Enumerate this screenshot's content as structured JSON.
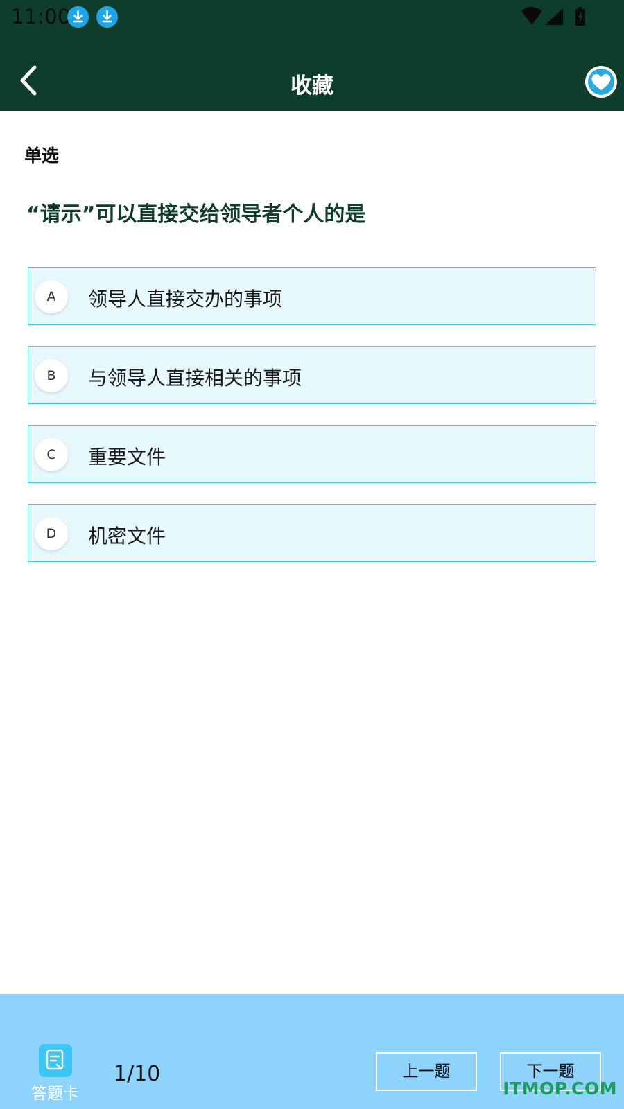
{
  "status_bar": {
    "time": "11:00"
  },
  "header": {
    "title": "收藏"
  },
  "question": {
    "type": "单选",
    "text": "“请示”可以直接交给领导者个人的是",
    "options": [
      {
        "letter": "A",
        "text": "领导人直接交办的事项"
      },
      {
        "letter": "B",
        "text": "与领导人直接相关的事项"
      },
      {
        "letter": "C",
        "text": "重要文件"
      },
      {
        "letter": "D",
        "text": "机密文件"
      }
    ]
  },
  "footer": {
    "answer_card_label": "答题卡",
    "progress": "1/10",
    "prev_label": "上一题",
    "next_label": "下一题"
  },
  "watermark": "ITMOP.COM",
  "colors": {
    "header_bg": "#0f3d2b",
    "option_bg": "#e6f8fc",
    "option_border": "#3dcfe0",
    "bottom_bar_bg": "#8ed3fc",
    "accent": "#28a9e0"
  }
}
